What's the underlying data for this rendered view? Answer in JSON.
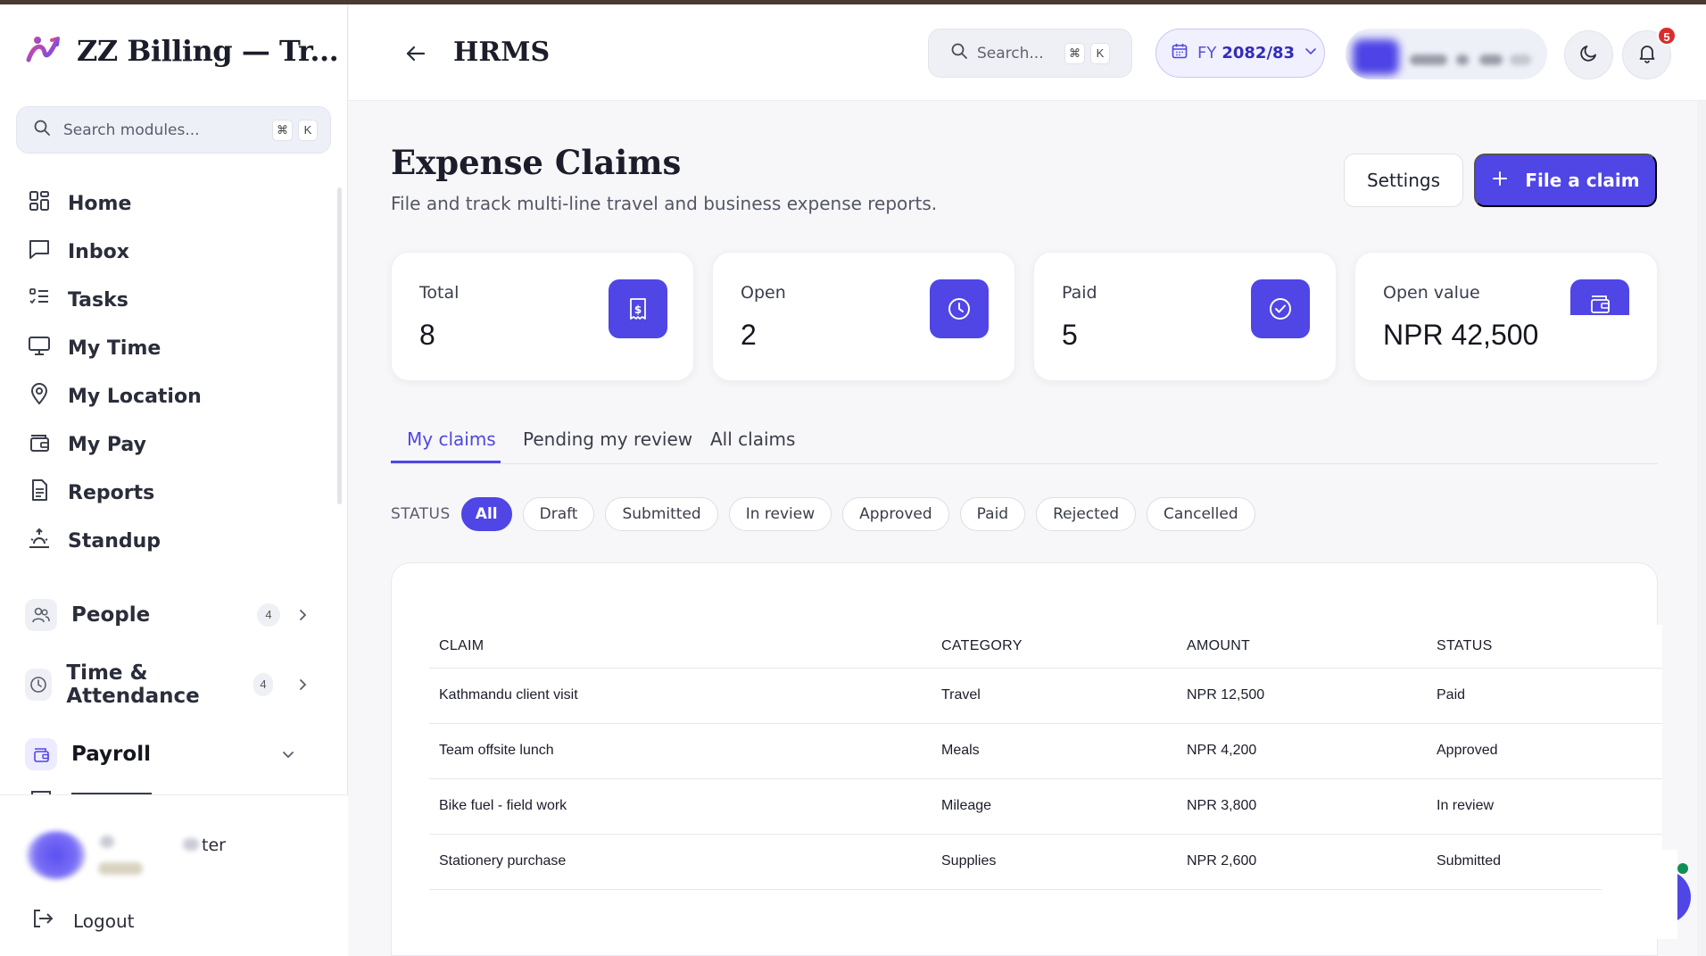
{
  "app": {
    "title": "ZZ Billing — Tr...",
    "brand_color": "#4f46e5"
  },
  "sidebar": {
    "search_placeholder": "Search modules...",
    "search_shortcut": [
      "⌘",
      "K"
    ],
    "items": [
      {
        "label": "Home",
        "icon": "grid-icon"
      },
      {
        "label": "Inbox",
        "icon": "message-icon"
      },
      {
        "label": "Tasks",
        "icon": "task-list-icon"
      },
      {
        "label": "My Time",
        "icon": "monitor-icon"
      },
      {
        "label": "My Location",
        "icon": "map-pin-icon"
      },
      {
        "label": "My Pay",
        "icon": "wallet-icon"
      },
      {
        "label": "Reports",
        "icon": "document-icon"
      },
      {
        "label": "Standup",
        "icon": "sunrise-icon"
      }
    ],
    "groups": [
      {
        "label": "People",
        "count": "4",
        "icon": "users-icon"
      },
      {
        "label": "Time & Attendance",
        "count": "4",
        "icon": "clock-icon"
      },
      {
        "label": "Payroll",
        "icon": "wallet-icon",
        "expanded": true
      }
    ],
    "user_role_partial": "ter",
    "logout_label": "Logout"
  },
  "header": {
    "title": "HRMS",
    "search_placeholder": "Search...",
    "search_shortcut": [
      "⌘",
      "K"
    ],
    "fiscal_year_label": "FY",
    "fiscal_year_value": "2082/83",
    "notification_count": "5"
  },
  "page": {
    "title": "Expense Claims",
    "subtitle": "File and track multi-line travel and business expense reports.",
    "settings_label": "Settings",
    "file_claim_label": "File a claim"
  },
  "stats": [
    {
      "label": "Total",
      "value": "8",
      "icon": "receipt-icon"
    },
    {
      "label": "Open",
      "value": "2",
      "icon": "clock-icon"
    },
    {
      "label": "Paid",
      "value": "5",
      "icon": "check-circle-icon"
    },
    {
      "label": "Open value",
      "value": "NPR 42,500",
      "icon": "wallet-icon"
    }
  ],
  "tabs": [
    "My claims",
    "Pending my review",
    "All claims"
  ],
  "status_filter": {
    "label": "STATUS",
    "options": [
      "All",
      "Draft",
      "Submitted",
      "In review",
      "Approved",
      "Paid",
      "Rejected",
      "Cancelled"
    ],
    "selected": "All"
  },
  "table": {
    "columns": [
      "CLAIM",
      "CATEGORY",
      "AMOUNT",
      "STATUS"
    ],
    "rows": [
      [
        "Kathmandu client visit",
        "Travel",
        "NPR 12,500",
        "Paid"
      ],
      [
        "Team offsite lunch",
        "Meals",
        "NPR 4,200",
        "Approved"
      ],
      [
        "Bike fuel - field work",
        "Mileage",
        "NPR 3,800",
        "In review"
      ],
      [
        "Stationery purchase",
        "Supplies",
        "NPR 2,600",
        "Submitted"
      ]
    ]
  }
}
